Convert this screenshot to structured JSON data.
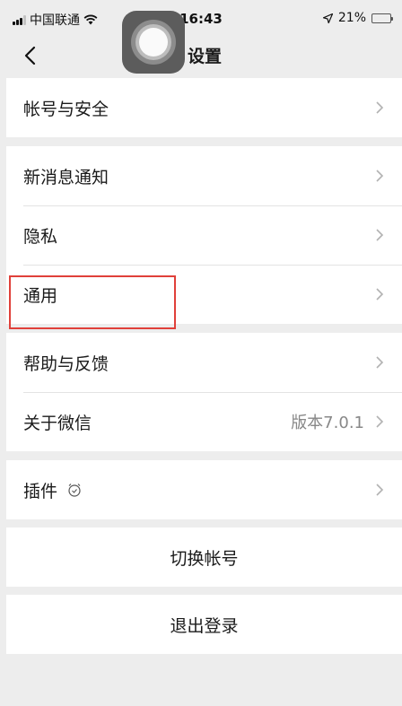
{
  "status_bar": {
    "carrier": "中国联通",
    "time": "16:43",
    "battery": "21%",
    "battery_level": 0.21
  },
  "nav": {
    "title": "设置"
  },
  "groups": [
    {
      "items": [
        {
          "label": "帐号与安全"
        }
      ]
    },
    {
      "items": [
        {
          "label": "新消息通知"
        },
        {
          "label": "隐私"
        },
        {
          "label": "通用"
        }
      ]
    },
    {
      "items": [
        {
          "label": "帮助与反馈"
        },
        {
          "label": "关于微信",
          "value": "版本7.0.1"
        }
      ]
    },
    {
      "items": [
        {
          "label": "插件"
        }
      ]
    }
  ],
  "actions": {
    "switch_account": "切换帐号",
    "logout": "退出登录"
  },
  "colors": {
    "background": "#ededed",
    "highlight": "#e0403a"
  },
  "icons": {
    "back": "chevron-left-icon",
    "chevron": "chevron-right-icon",
    "wifi": "wifi-icon",
    "location": "location-arrow-icon",
    "plugin": "alarm-clock-icon"
  }
}
